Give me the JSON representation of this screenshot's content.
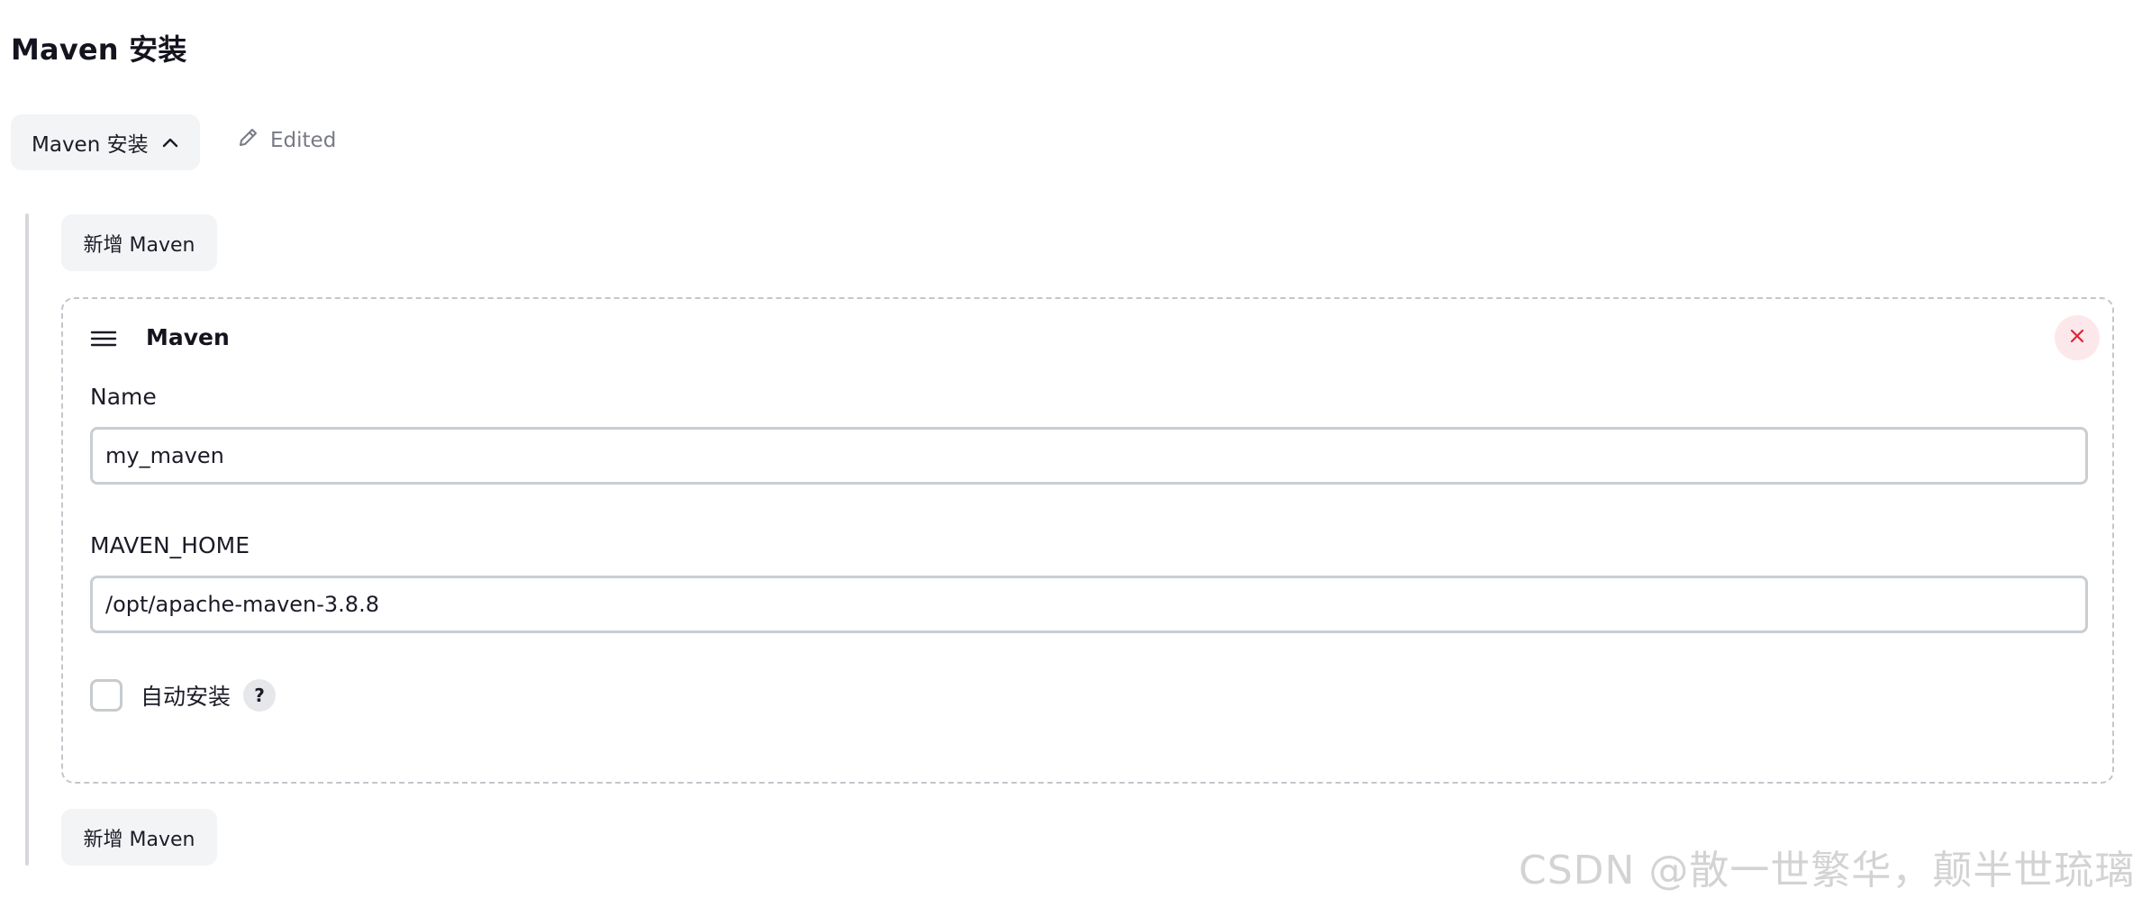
{
  "section": {
    "title": "Maven 安装",
    "toggle_label": "Maven 安装",
    "edited_label": "Edited",
    "add_button_label": "新增 Maven"
  },
  "maven_installation": {
    "title": "Maven",
    "name_label": "Name",
    "name_value": "my_maven",
    "home_label": "MAVEN_HOME",
    "home_value": "/opt/apache-maven-3.8.8",
    "auto_install_label": "自动安装",
    "auto_install_checked": false,
    "help_glyph": "?"
  },
  "icons": {
    "toggle": "chevron-up-icon",
    "edited": "pencil-icon",
    "drag": "hamburger-menu-icon",
    "delete": "close-icon"
  },
  "colors": {
    "delete_accent": "#e0223a",
    "button_bg": "#f3f4f6"
  },
  "watermark": "CSDN @散一世繁华，颠半世琉璃"
}
